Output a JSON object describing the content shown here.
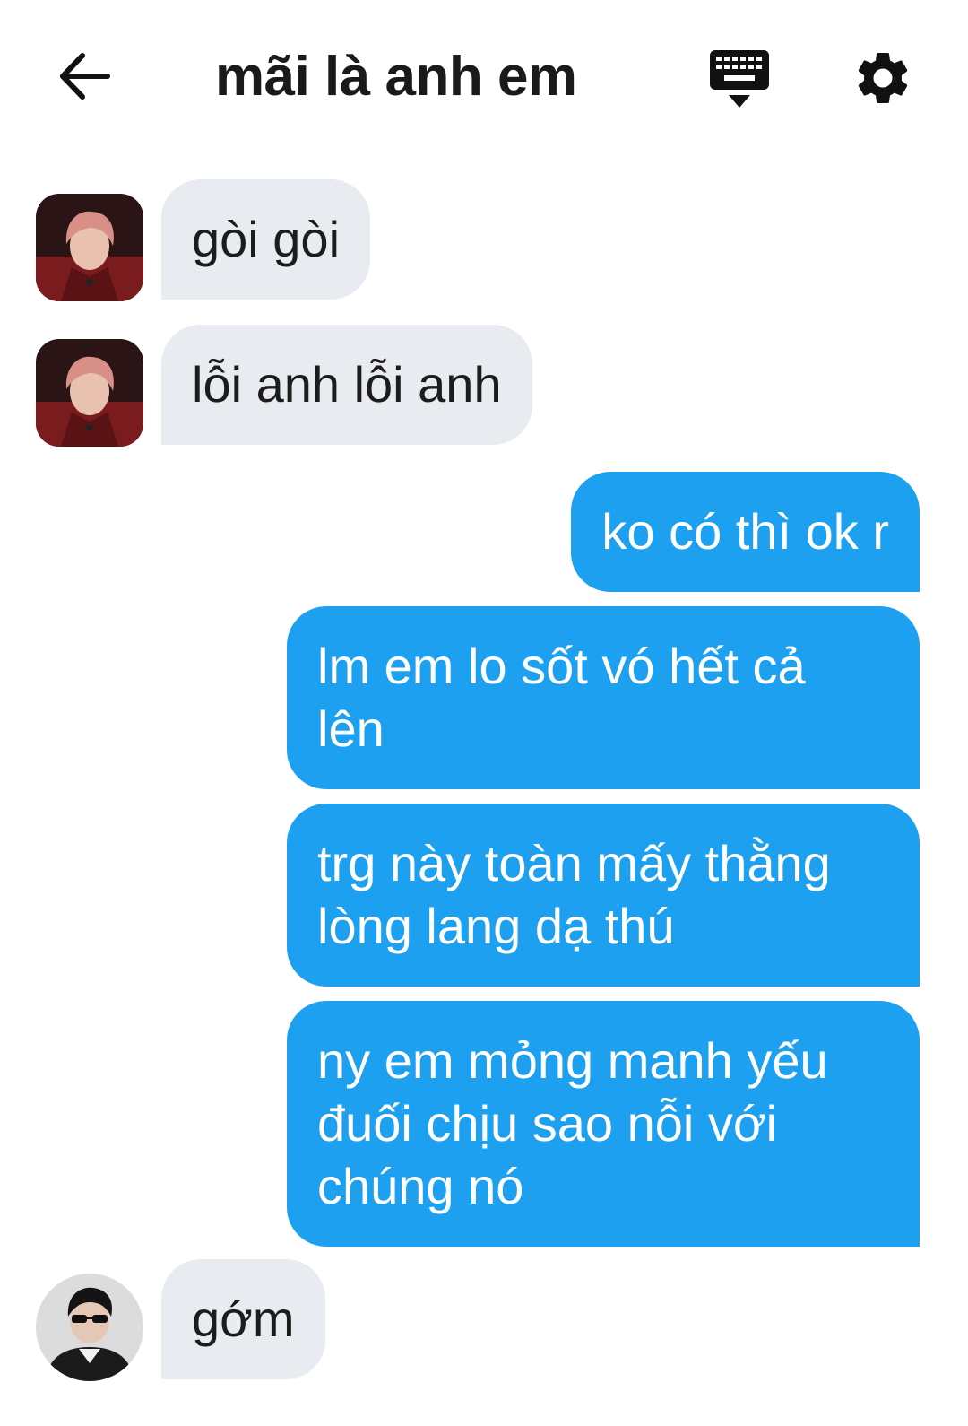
{
  "header": {
    "title": "mãi là anh em",
    "back_icon": "arrow-left-icon",
    "keyboard_icon": "keyboard-icon",
    "settings_icon": "gear-icon"
  },
  "messages": [
    {
      "direction": "in",
      "text": "gòi gòi",
      "avatar": "pink-hair-avatar"
    },
    {
      "direction": "in",
      "text": "lỗi anh lỗi anh",
      "avatar": "pink-hair-avatar"
    },
    {
      "direction": "out",
      "text": "ko có thì ok r"
    },
    {
      "direction": "out",
      "text": "lm em lo sốt vó hết cả\nlên"
    },
    {
      "direction": "out",
      "text": "trg này toàn mấy thằng\nlòng lang dạ thú"
    },
    {
      "direction": "out",
      "text": "ny em mỏng manh yếu\nđuối chịu sao nỗi với\nchúng nó"
    },
    {
      "direction": "in",
      "text": "gớm",
      "avatar": "sunglasses-avatar"
    }
  ],
  "colors": {
    "incoming_bubble": "#e8ebef",
    "outgoing_bubble": "#1da0ef",
    "title": "#1a1a1a"
  }
}
